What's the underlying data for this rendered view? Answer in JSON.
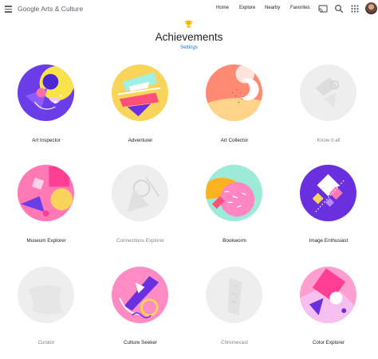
{
  "header": {
    "brand": "Google Arts & Culture",
    "nav": [
      "Home",
      "Explore",
      "Nearby",
      "Favorites"
    ],
    "icons": [
      "menu-icon",
      "cast-icon",
      "search-icon",
      "apps-icon",
      "avatar"
    ]
  },
  "page": {
    "title": "Achievements",
    "settings_label": "Settings"
  },
  "achievements": [
    {
      "label": "Art Inspector",
      "unlocked": true
    },
    {
      "label": "Adventurer",
      "unlocked": true
    },
    {
      "label": "Art Collector",
      "unlocked": true
    },
    {
      "label": "Know it all",
      "unlocked": false
    },
    {
      "label": "Museum Explorer",
      "unlocked": true
    },
    {
      "label": "Connections Explorer",
      "unlocked": false
    },
    {
      "label": "Bookworm",
      "unlocked": true
    },
    {
      "label": "Image Enthusiast",
      "unlocked": true
    },
    {
      "label": "Curator",
      "unlocked": false
    },
    {
      "label": "Culture Seeker",
      "unlocked": true
    },
    {
      "label": "Chromecast",
      "unlocked": false
    },
    {
      "label": "Color Explorer",
      "unlocked": true
    }
  ],
  "colors": {
    "accent_link": "#1a73e8",
    "locked_text": "#80868b",
    "locked_disc": "#eeeeee"
  }
}
